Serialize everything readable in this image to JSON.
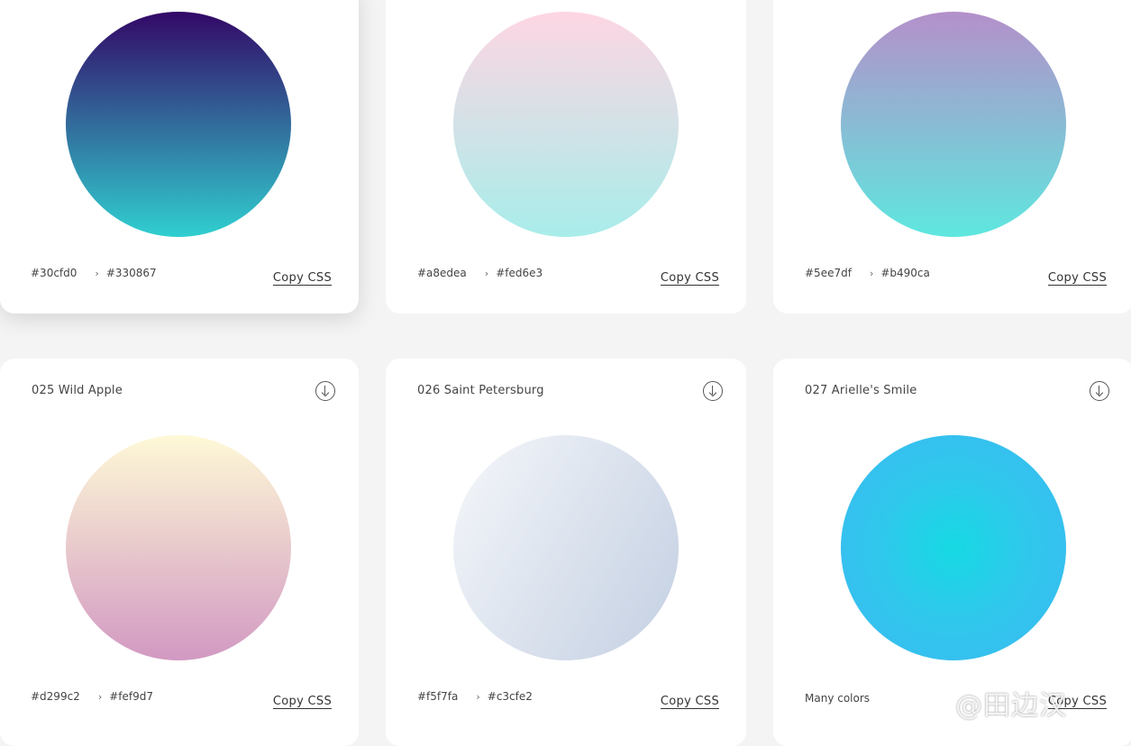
{
  "cards": [
    {
      "from": "#30cfd0",
      "to": "#330867",
      "copy_label": "Copy CSS",
      "gradient": [
        "#30cfd0",
        "#330867"
      ]
    },
    {
      "from": "#a8edea",
      "to": "#fed6e3",
      "copy_label": "Copy CSS",
      "gradient": [
        "#a8edea",
        "#fed6e3"
      ]
    },
    {
      "from": "#5ee7df",
      "to": "#b490ca",
      "copy_label": "Copy CSS",
      "gradient": [
        "#5ee7df",
        "#b490ca"
      ]
    },
    {
      "title": "025 Wild Apple",
      "from": "#d299c2",
      "to": "#fef9d7",
      "copy_label": "Copy CSS",
      "gradient": [
        "#d299c2",
        "#fef9d7"
      ]
    },
    {
      "title": "026 Saint Petersburg",
      "from": "#f5f7fa",
      "to": "#c3cfe2",
      "copy_label": "Copy CSS",
      "gradient": [
        "#f5f7fa",
        "#c3cfe2"
      ]
    },
    {
      "title": "027 Arielle's Smile",
      "many_label": "Many colors",
      "copy_label": "Copy CSS",
      "gradient": [
        "#16d9e3",
        "#30c7ec",
        "#46aef7"
      ]
    }
  ],
  "arrow_glyph": "›",
  "icons": {
    "download": "download-circle-icon"
  },
  "watermark": "@田边汉"
}
